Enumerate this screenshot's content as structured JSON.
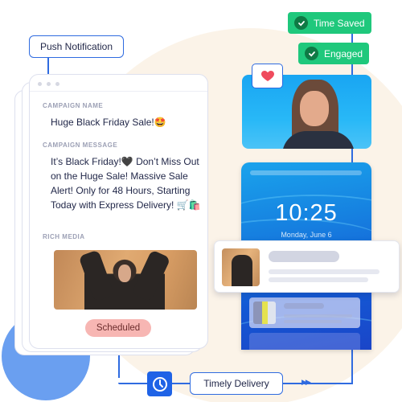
{
  "flow": {
    "push_notification_label": "Push Notification",
    "timely_delivery_label": "Timely Delivery",
    "clock_icon": "clock-icon",
    "arrow_icon": "double-arrow-right-icon"
  },
  "campaign_card": {
    "window_dots": 3,
    "campaign_name_label": "CAMPAIGN NAME",
    "campaign_name_value": "Huge Black Friday Sale!🤩",
    "campaign_message_label": "CAMPAIGN MESSAGE",
    "campaign_message_value": "It’s Black Friday!🖤 Don’t Miss Out on the Huge Sale! Massive Sale Alert! Only for 48 Hours, Starting Today with Express Delivery! 🛒🛍️",
    "rich_media_label": "RICH MEDIA",
    "rich_media_image": "woman-in-black-blazer-photo",
    "status_badge": "Scheduled"
  },
  "outcomes": [
    {
      "label": "Time Saved",
      "icon": "check-circle-icon"
    },
    {
      "label": "Engaged",
      "icon": "check-circle-icon"
    }
  ],
  "engagement": {
    "icon": "heart-icon",
    "photo": "smiling-woman-photo"
  },
  "phone": {
    "time": "10:25",
    "date": "Monday, June 6"
  },
  "colors": {
    "accent_blue": "#2f6be0",
    "success_green": "#1fc87c",
    "scheduled_pink": "#f7b6b3",
    "heart_red": "#ef4b5d"
  }
}
